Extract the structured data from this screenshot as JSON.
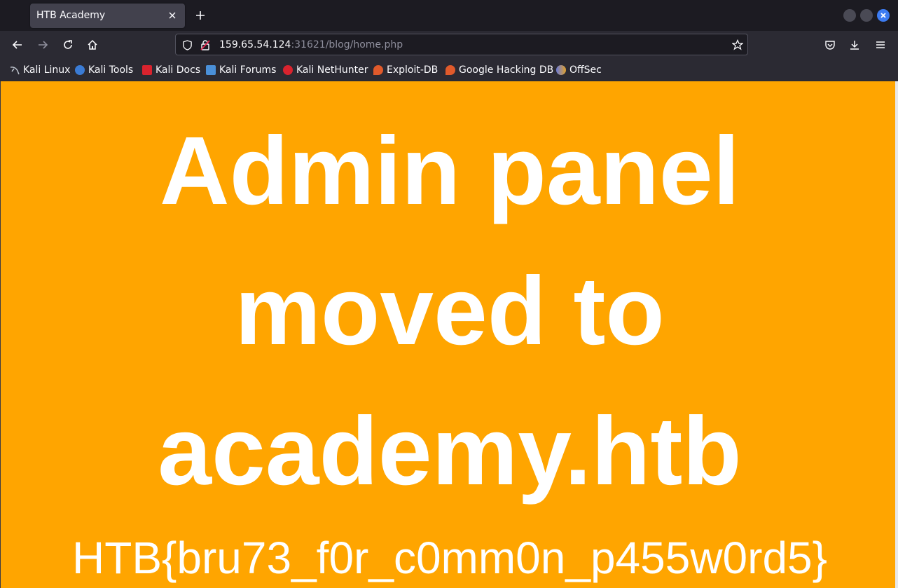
{
  "browser": {
    "tab": {
      "title": "HTB Academy",
      "close_icon": "close-icon"
    },
    "new_tab_icon": "plus-icon",
    "window_controls": {
      "close_color": "#3d7cf2"
    }
  },
  "navbar": {
    "url_host": "159.65.54.124",
    "url_rest": ":31621/blog/home.php"
  },
  "bookmarks": [
    {
      "label": "Kali Linux",
      "icon": "kali-dragon-icon",
      "color": "#9aa4b5"
    },
    {
      "label": "Kali Tools",
      "icon": "kali-tools-icon",
      "color": "#3a7bd5"
    },
    {
      "label": "Kali Docs",
      "icon": "kali-docs-icon",
      "color": "#d9232e"
    },
    {
      "label": "Kali Forums",
      "icon": "kali-forums-icon",
      "color": "#4a90d9"
    },
    {
      "label": "Kali NetHunter",
      "icon": "nethunter-icon",
      "color": "#d9232e"
    },
    {
      "label": "Exploit-DB",
      "icon": "exploit-db-icon",
      "color": "#e05a2b"
    },
    {
      "label": "Google Hacking DB",
      "icon": "ghdb-icon",
      "color": "#e05a2b"
    },
    {
      "label": "OffSec",
      "icon": "offsec-icon",
      "color": "#6a7bd9"
    }
  ],
  "page": {
    "background": "#ffa500",
    "headline": [
      "Admin panel",
      "moved to",
      "academy.htb"
    ],
    "flag": "HTB{bru73_f0r_c0mm0n_p455w0rd5}"
  }
}
